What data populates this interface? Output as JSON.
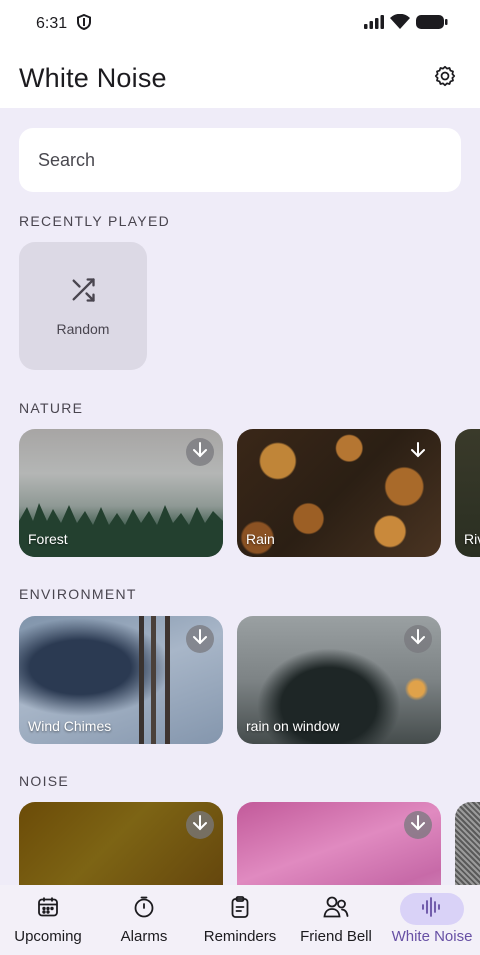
{
  "status_bar": {
    "time": "6:31"
  },
  "header": {
    "title": "White Noise"
  },
  "search": {
    "placeholder": "Search"
  },
  "recently_played": {
    "label": "RECENTLY PLAYED",
    "items": [
      {
        "label": "Random",
        "icon": "shuffle-icon"
      }
    ]
  },
  "nature": {
    "label": "NATURE",
    "items": [
      {
        "label": "Forest"
      },
      {
        "label": "Rain"
      },
      {
        "label": "Riv"
      }
    ]
  },
  "environment": {
    "label": "ENVIRONMENT",
    "items": [
      {
        "label": "Wind Chimes"
      },
      {
        "label": "rain on window"
      }
    ]
  },
  "noise": {
    "label": "NOISE",
    "items": [
      {
        "label": ""
      },
      {
        "label": ""
      },
      {
        "label": ""
      }
    ]
  },
  "bottom_nav": {
    "items": [
      {
        "label": "Upcoming",
        "icon": "calendar-icon"
      },
      {
        "label": "Alarms",
        "icon": "timer-icon"
      },
      {
        "label": "Reminders",
        "icon": "clipboard-icon"
      },
      {
        "label": "Friend Bell",
        "icon": "people-icon"
      },
      {
        "label": "White Noise",
        "icon": "waveform-icon",
        "active": true
      }
    ]
  },
  "colors": {
    "accent": "#6750a4",
    "background": "#efecf8",
    "active_pill": "#d9d2f7"
  }
}
